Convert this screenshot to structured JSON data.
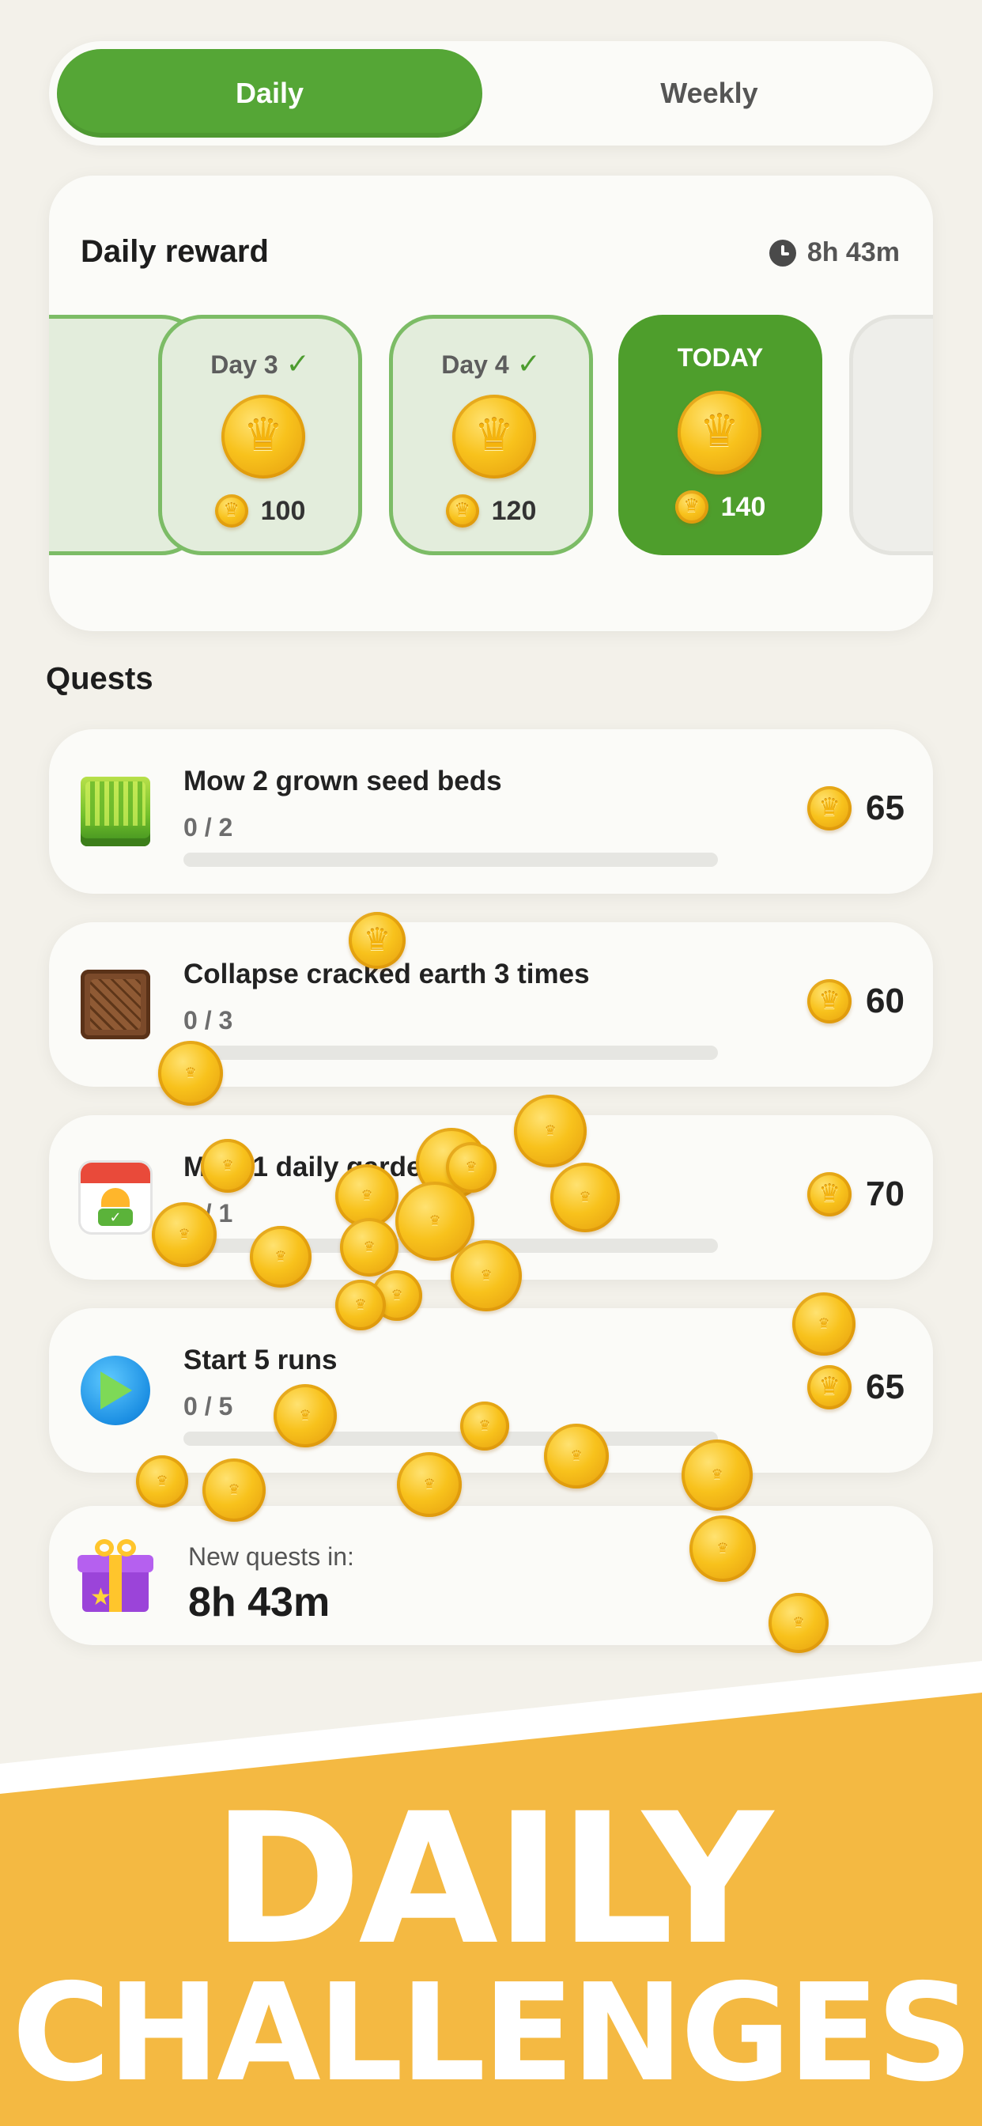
{
  "tabs": {
    "daily": "Daily",
    "weekly": "Weekly"
  },
  "reward": {
    "title": "Daily reward",
    "timer": "8h 43m",
    "days": [
      {
        "label": "Day 3",
        "amount": "100"
      },
      {
        "label": "Day 4",
        "amount": "120"
      },
      {
        "label": "TODAY",
        "amount": "140"
      }
    ]
  },
  "quests": {
    "heading": "Quests",
    "items": [
      {
        "title": "Mow 2 grown seed beds",
        "progress": "0 / 2",
        "reward": "65",
        "icon": "grass-icon"
      },
      {
        "title": "Collapse cracked earth 3 times",
        "progress": "0 / 3",
        "reward": "60",
        "icon": "cracked-earth-icon"
      },
      {
        "title": "Mow 1 daily garden",
        "progress": "0 / 1",
        "reward": "70",
        "icon": "calendar-icon"
      },
      {
        "title": "Start 5 runs",
        "progress": "0 / 5",
        "reward": "65",
        "icon": "play-icon"
      }
    ],
    "new_label": "New quests in:",
    "new_time": "8h 43m"
  },
  "banner": {
    "line1": "DAILY",
    "line2": "CHALLENGES"
  },
  "colors": {
    "green": "#55a636",
    "today_green": "#4e9e2c",
    "banner": "#f4b942",
    "coin": "#f8c21c"
  }
}
